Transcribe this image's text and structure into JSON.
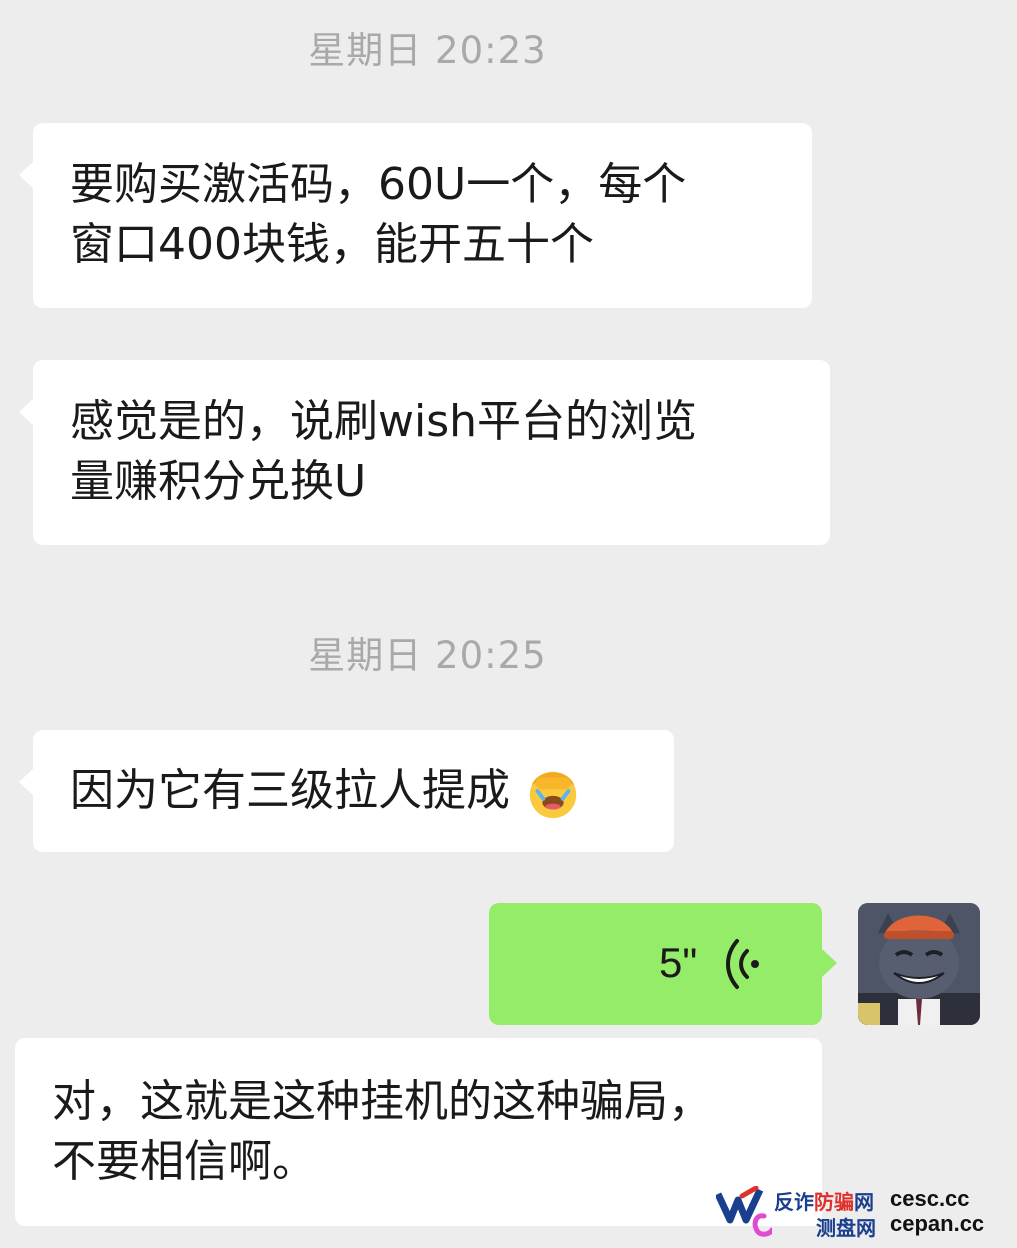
{
  "timestamps": [
    "星期日 20:23",
    "星期日 20:25"
  ],
  "messages": [
    {
      "side": "left",
      "lines": [
        "要购买激活码，60U一个，每个",
        "窗口400块钱，能开五十个"
      ]
    },
    {
      "side": "left",
      "lines": [
        "感觉是的，说刷wish平台的浏览",
        "量赚积分兑换U"
      ]
    },
    {
      "side": "left",
      "text": "因为它有三级拉人提成",
      "emoji": "facepalm-emoji"
    },
    {
      "side": "right",
      "type": "voice",
      "duration": "5\"",
      "icon": "voice-wave-icon"
    },
    {
      "side": "left",
      "lines": [
        "对，这就是这种挂机的这种骗局，",
        "不要相信啊。"
      ]
    }
  ],
  "watermark": {
    "line1_prefix": "反诈",
    "line1_red": "防骗",
    "line1_suffix": "网",
    "line2": "测盘网",
    "domain1": "cesc.cc",
    "domain2": "cepan.cc"
  },
  "colors": {
    "background": "#ededed",
    "bubble_left": "#ffffff",
    "bubble_right": "#95ec69",
    "timestamp": "#a9a9a9"
  }
}
